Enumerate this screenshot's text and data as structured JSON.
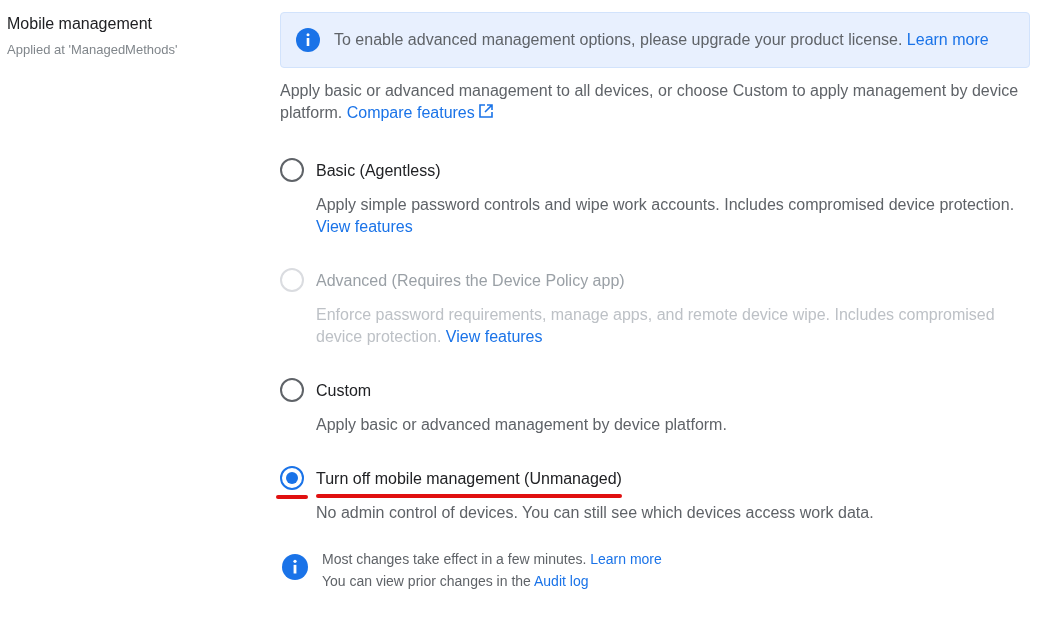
{
  "section": {
    "title": "Mobile management",
    "subtitle": "Applied at 'ManagedMethods'"
  },
  "notice": {
    "text": "To enable advanced management options, please upgrade your product license.",
    "link": "Learn more"
  },
  "description": {
    "text": "Apply basic or advanced management to all devices, or choose Custom to apply management by device platform.",
    "link": "Compare features"
  },
  "options": [
    {
      "label": "Basic (Agentless)",
      "description": "Apply simple password controls and wipe work accounts. Includes compromised device protection.",
      "link": "View features",
      "selected": false,
      "disabled": false,
      "underlined": false
    },
    {
      "label": "Advanced (Requires the Device Policy app)",
      "description": "Enforce password requirements, manage apps, and remote device wipe. Includes compromised device protection.",
      "link": "View features",
      "selected": false,
      "disabled": true,
      "underlined": false
    },
    {
      "label": "Custom",
      "description": "Apply basic or advanced management by device platform.",
      "selected": false,
      "disabled": false,
      "underlined": false
    },
    {
      "label": "Turn off mobile management (Unmanaged)",
      "description": "No admin control of devices. You can still see which devices access work data.",
      "selected": true,
      "disabled": false,
      "underlined": true
    }
  ],
  "footer": [
    {
      "text": "Most changes take effect in a few minutes.",
      "link": "Learn more"
    },
    {
      "text": "You can view prior changes in the",
      "link": "Audit log"
    }
  ]
}
